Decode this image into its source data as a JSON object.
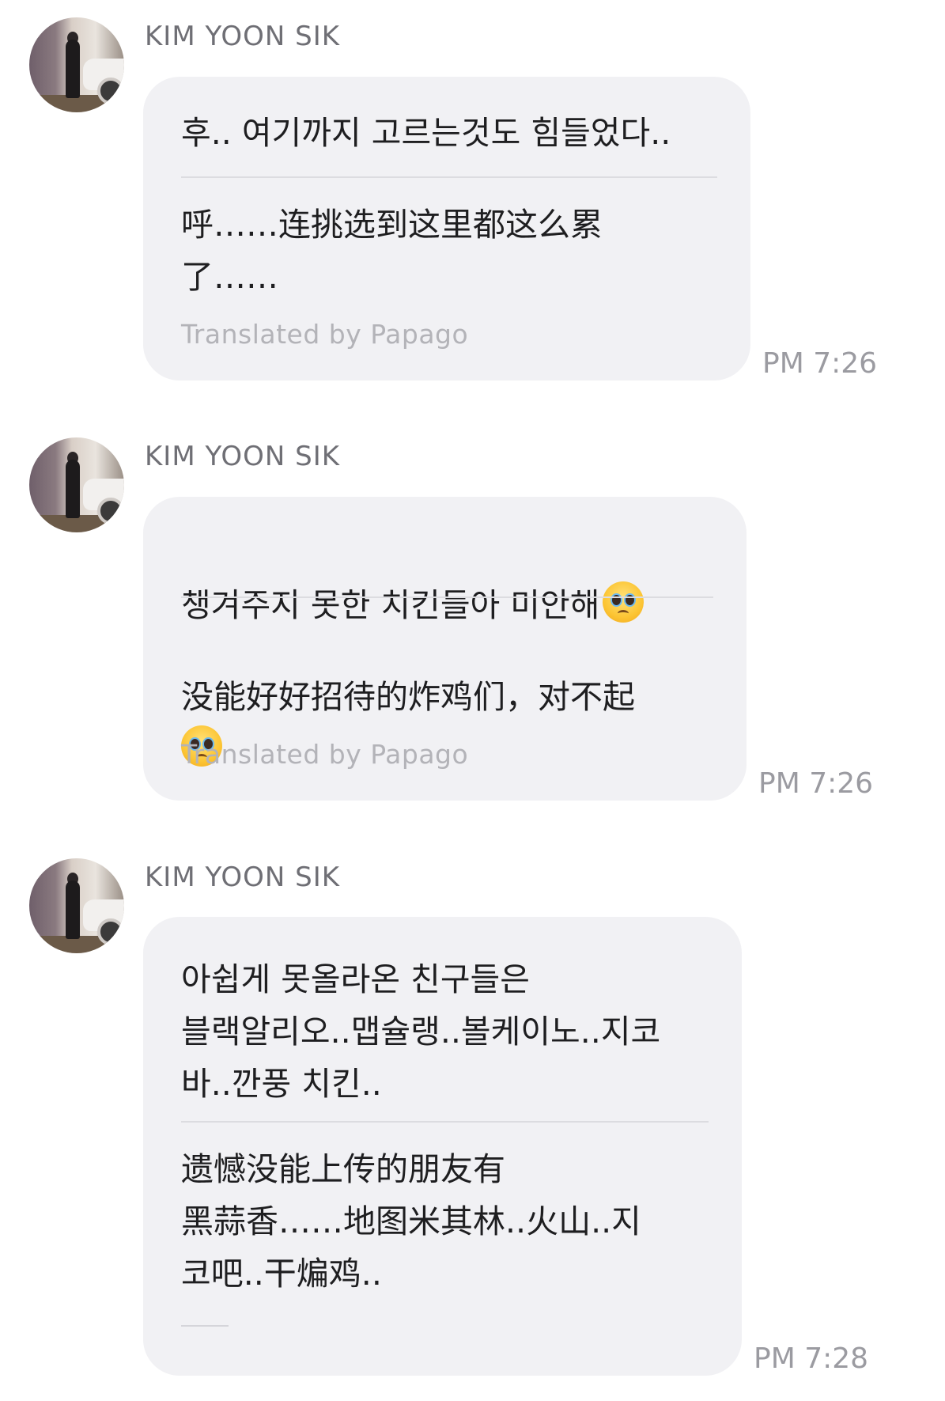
{
  "messages": [
    {
      "sender": "KIM YOON SIK",
      "original": "후.. 여기까지 고르는것도 힘들었다..",
      "translated": "呼……连挑选到这里都这么累\n了……",
      "translated_by": "Translated by Papago",
      "time": "PM 7:26",
      "emoji": false
    },
    {
      "sender": "KIM YOON SIK",
      "original": "챙겨주지 못한 치킨들아 미안해",
      "translated": "没能好好招待的炸鸡们，对不起",
      "translated_by": "Translated by Papago",
      "time": "PM 7:26",
      "emoji": true,
      "emoji_icon": "pleading-face-emoji"
    },
    {
      "sender": "KIM YOON SIK",
      "original": "아쉽게 못올라온 친구들은\n블랙알리오..맵슐랭..볼케이노..지코\n바..깐풍 치킨..",
      "translated": "遗憾没能上传的朋友有\n黑蒜香……地图米其林..火山..지\n코吧..干煸鸡..",
      "time": "PM 7:28"
    }
  ]
}
